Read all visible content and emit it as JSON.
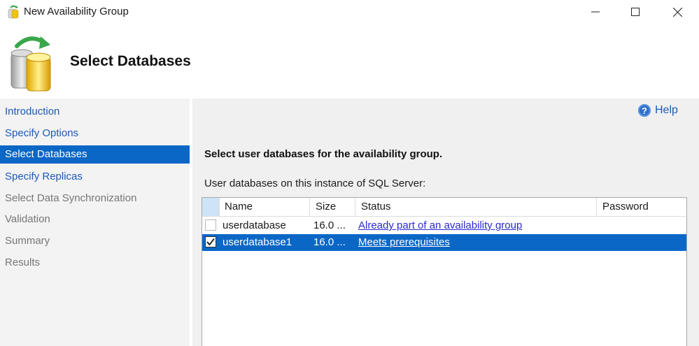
{
  "window": {
    "title": "New Availability Group",
    "controls": [
      "minimize-icon",
      "maximize-icon",
      "close-icon"
    ]
  },
  "header": {
    "title": "Select Databases"
  },
  "sidebar": {
    "items": [
      {
        "label": "Introduction",
        "state": "enabled"
      },
      {
        "label": "Specify Options",
        "state": "enabled"
      },
      {
        "label": "Select Databases",
        "state": "selected"
      },
      {
        "label": "Specify Replicas",
        "state": "enabled"
      },
      {
        "label": "Select Data Synchronization",
        "state": "disabled"
      },
      {
        "label": "Validation",
        "state": "disabled"
      },
      {
        "label": "Summary",
        "state": "disabled"
      },
      {
        "label": "Results",
        "state": "disabled"
      }
    ]
  },
  "main": {
    "help_label": "Help",
    "instruction": "Select user databases for the availability group.",
    "list_label": "User databases on this instance of SQL Server:",
    "table": {
      "columns": [
        "Name",
        "Size",
        "Status",
        "Password"
      ],
      "rows": [
        {
          "checked": false,
          "name": "userdatabase",
          "size": "16.0 ...",
          "status": "Already part of an availability group",
          "password": "",
          "selected": false
        },
        {
          "checked": true,
          "name": "userdatabase1",
          "size": "16.0 ...",
          "status": "Meets prerequisites",
          "password": "",
          "selected": true
        }
      ]
    }
  },
  "colors": {
    "accent": "#0a67c6",
    "link": "#1b5ab5",
    "sidebar_bg": "#f3f3f3",
    "panel_bg": "#f0f0f0"
  }
}
